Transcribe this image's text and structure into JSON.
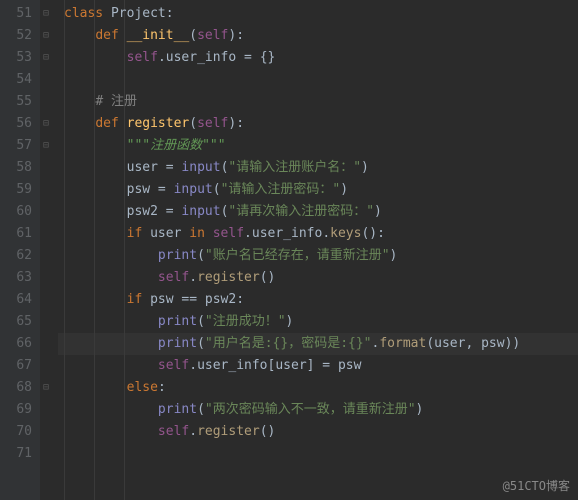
{
  "watermark": "@51CTO博客",
  "line_numbers": [
    "51",
    "52",
    "53",
    "54",
    "55",
    "56",
    "57",
    "58",
    "59",
    "60",
    "61",
    "62",
    "63",
    "64",
    "65",
    "66",
    "67",
    "68",
    "69",
    "70",
    "71"
  ],
  "fold_marks": {
    "0": "⊟",
    "1": "⊟",
    "2": "⊟",
    "5": "⊟",
    "6": "⊟",
    "17": "⊟"
  },
  "highlighted_line": 15,
  "code": {
    "l0": {
      "kw_class": "class",
      "name": "Project",
      "colon": ":"
    },
    "l1": {
      "kw_def": "def",
      "name": "__init__",
      "p_open": "(",
      "self": "self",
      "p_close": ")",
      "colon": ":"
    },
    "l2": {
      "self": "self",
      "dot": ".",
      "attr": "user_info",
      "assign": " = ",
      "val": "{}"
    },
    "l3": {},
    "l4": {
      "comment": "# 注册"
    },
    "l5": {
      "kw_def": "def",
      "name": "register",
      "p_open": "(",
      "self": "self",
      "p_close": ")",
      "colon": ":"
    },
    "l6": {
      "docstr": "\"\"\"注册函数\"\"\""
    },
    "l7": {
      "var": "user",
      "assign": " = ",
      "fn": "input",
      "p_open": "(",
      "str": "\"请输入注册账户名：\"",
      "p_close": ")"
    },
    "l8": {
      "var": "psw",
      "assign": " = ",
      "fn": "input",
      "p_open": "(",
      "str": "\"请输入注册密码：\"",
      "p_close": ")"
    },
    "l9": {
      "var": "psw2",
      "assign": " = ",
      "fn": "input",
      "p_open": "(",
      "str": "\"请再次输入注册密码：\"",
      "p_close": ")"
    },
    "l10": {
      "kw_if": "if",
      "var": "user",
      "kw_in": "in",
      "self": "self",
      "dot": ".",
      "attr": "user_info",
      "dot2": ".",
      "method": "keys",
      "p_open": "(",
      "p_close": ")",
      "colon": ":"
    },
    "l11": {
      "fn": "print",
      "p_open": "(",
      "str": "\"账户名已经存在，请重新注册\"",
      "p_close": ")"
    },
    "l12": {
      "self": "self",
      "dot": ".",
      "method": "register",
      "p_open": "(",
      "p_close": ")"
    },
    "l13": {
      "kw_if": "if",
      "var1": "psw",
      "eq": " == ",
      "var2": "psw2",
      "colon": ":"
    },
    "l14": {
      "fn": "print",
      "p_open": "(",
      "str": "\"注册成功！\"",
      "p_close": ")"
    },
    "l15": {
      "fn": "print",
      "p_open": "(",
      "str": "\"用户名是:{}，密码是:{}\"",
      "dot": ".",
      "method": "format",
      "p2_open": "(",
      "a1": "user",
      "comma": ", ",
      "a2": "psw",
      "p2_close": ")",
      "p_close": ")"
    },
    "l16": {
      "self": "self",
      "dot": ".",
      "attr": "user_info",
      "br_open": "[",
      "idx": "user",
      "br_close": "]",
      "assign": " = ",
      "val": "psw"
    },
    "l17": {
      "kw_else": "else",
      "colon": ":"
    },
    "l18": {
      "fn": "print",
      "p_open": "(",
      "str": "\"两次密码输入不一致，请重新注册\"",
      "p_close": ")"
    },
    "l19": {
      "self": "self",
      "dot": ".",
      "method": "register",
      "p_open": "(",
      "p_close": ")"
    },
    "l20": {}
  }
}
